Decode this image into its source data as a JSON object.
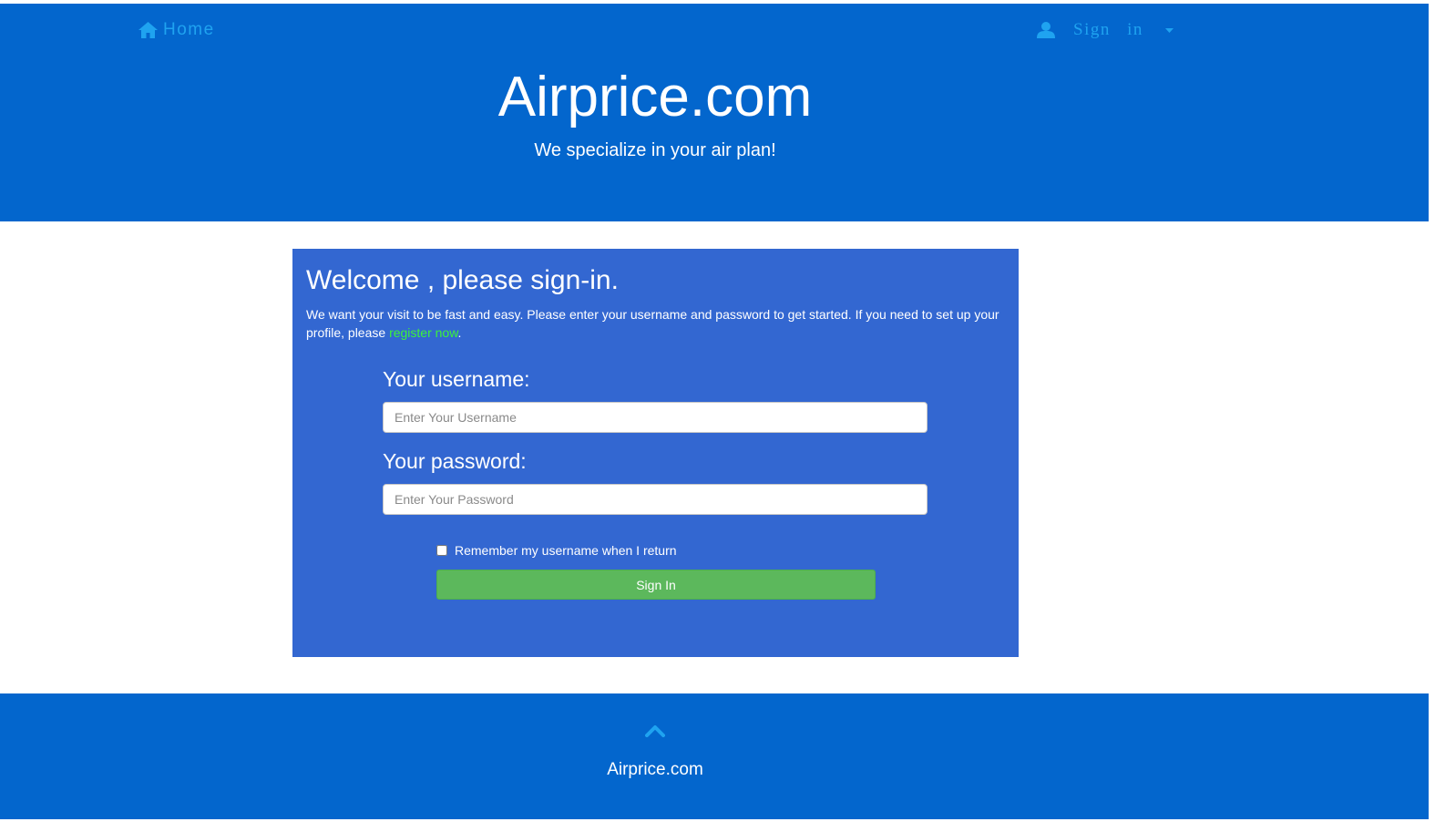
{
  "nav": {
    "home_label": "Home",
    "signin_label": "Sign in",
    "icons": {
      "home": "home-icon",
      "user": "user-icon",
      "caret": "caret-down-icon"
    },
    "link_color": "#1fa3f0"
  },
  "header": {
    "title": "Airprice.com",
    "tagline": "We specialize in your air plan!",
    "background": "#0366cd"
  },
  "signin_panel": {
    "heading": "Welcome , please sign-in.",
    "intro_text": "We want your visit to be fast and easy. Please enter your username and password to get started. If you need to set up your profile, please ",
    "register_link": "register now",
    "intro_suffix": ".",
    "username_label": "Your username:",
    "username_placeholder": "Enter Your Username",
    "username_value": "",
    "password_label": "Your password:",
    "password_placeholder": "Enter Your Password",
    "password_value": "",
    "remember_label": "Remember my username when I return",
    "remember_checked": false,
    "submit_label": "Sign In",
    "background": "#3367d1",
    "submit_color": "#5cb85c",
    "link_color": "#3cf23c"
  },
  "footer": {
    "brand": "Airprice.com",
    "up_icon": "chevron-up-icon"
  }
}
